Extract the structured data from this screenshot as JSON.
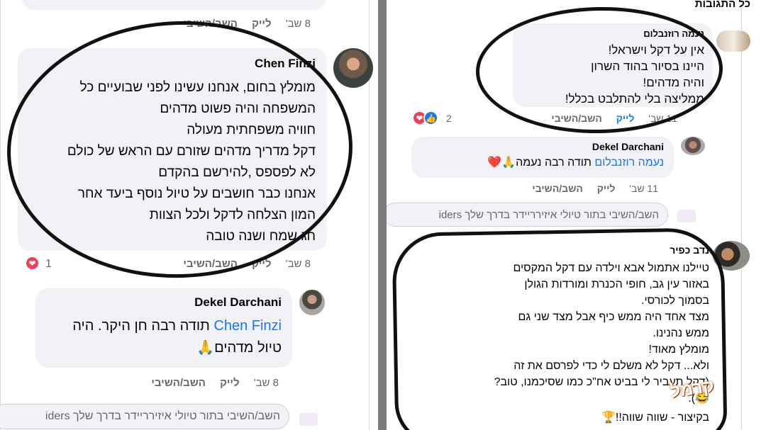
{
  "left": {
    "top_meta": {
      "time": "8 שב'",
      "like": "לייק",
      "reply": "השב/השיבי"
    },
    "comment1": {
      "author": "Chen Finzi",
      "lines": [
        "מומלץ בחום, אנחנו עשינו לפני שבועיים כל",
        "המשפחה והיה פשוט מדהים",
        "חוויה משפחתית מעולה",
        "דקל מדריך מדהים שזורם עם הראש של כולם",
        "לא לפספס ,להירשם בהקדם",
        "אנחנו כבר חושבים על טיול נוסף ביעד אחר",
        "המון הצלחה לדקל ולכל הצוות",
        "חג שמח ושנה טובה"
      ],
      "time": "8 שב'",
      "like": "לייק",
      "reply": "השב/השיבי",
      "reaction_count": "1"
    },
    "comment2": {
      "author": "Dekel Darchani",
      "tag": "Chen Finzi",
      "text1": "תודה רבה חן היקר. היה",
      "text2": "טיול מדהים🙏",
      "time": "8 שב'",
      "like": "לייק",
      "reply": "השב/השיבי"
    },
    "reply_placeholder": "השב/השיבי בתור טיולי איזירריידר בדרך שלך iders"
  },
  "right": {
    "section_title": "כל התגובות",
    "comment1": {
      "author": "נעמה רוזנבלום",
      "lines": [
        "אין על דקל וישראל!",
        "היינו בסיור בהוד השרון",
        "והיה מדהים!",
        "ממליצה בלי להתלבט בכלל!"
      ],
      "time": "11 שב'",
      "like": "לייק",
      "reply": "השב/השיבי",
      "reaction_count": "2"
    },
    "comment2": {
      "author": "Dekel Darchani",
      "tag": "נעמה רוזנבלום",
      "text": "תודה רבה נעמה🙏❤️",
      "time": "11 שב'",
      "like": "לייק",
      "reply": "השב/השיבי"
    },
    "reply_placeholder": "השב/השיבי בתור טיולי איזירריידר בדרך שלך iders",
    "comment3": {
      "author": "נדב כפיר",
      "lines": [
        "טיילנו אתמול אבא וילדה עם דקל המקסים",
        "באזור עין גב, חופי הכנרת ומורדות הגולן",
        "בסמוך לכורסי.",
        "מצד אחד היה ממש כיף אבל מצד שני גם",
        "ממש נהנינו.",
        "מומלץ מאוד!",
        "ולא... דקל לא משלם לי כדי לפרסם את זה",
        "(דקל תעביר לי בביט אח\"כ כמו שסיכמנו, טוב?",
        "😂).",
        "בקיצור - שווה שווה!!🏆"
      ]
    },
    "watermark": "קרמל"
  },
  "colors": {
    "bubble": "#f0f2f5",
    "link": "#1877f2",
    "meta": "#65676b",
    "divider": "#7c7c7c"
  },
  "icons": [
    "heart-reaction-icon",
    "like-reaction-icon",
    "pray-emoji-icon",
    "heart-emoji-icon",
    "trophy-emoji-icon",
    "laugh-emoji-icon"
  ]
}
